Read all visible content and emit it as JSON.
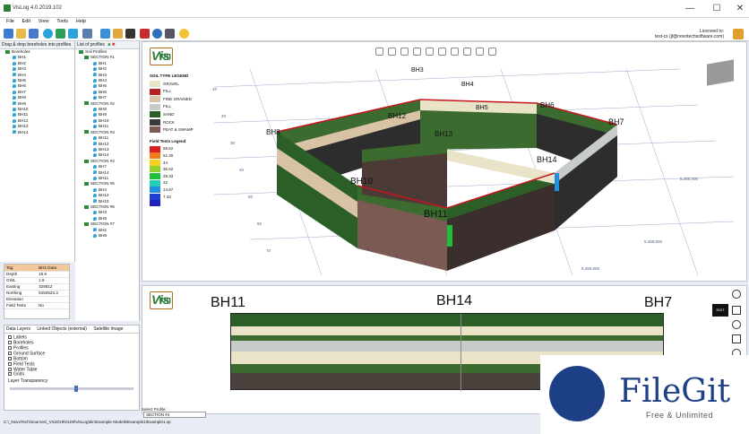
{
  "window": {
    "title": "VisLog 4.0.2019.102",
    "minimize": "—",
    "maximize": "☐",
    "close": "✕"
  },
  "menu": [
    "File",
    "Edit",
    "View",
    "Tools",
    "Help"
  ],
  "license": {
    "line1": "Licensed to:",
    "line2": "test-cs (jf@novotechsoftware.com)"
  },
  "boreholes_panel": {
    "header": "Drag & drop boreholes into profiles",
    "root": "Boreholes",
    "items": [
      "BH1",
      "BH2",
      "BH3",
      "BH4",
      "BH5",
      "BH6",
      "BH7",
      "BH8",
      "BH9",
      "BH10",
      "BH11",
      "BH12",
      "BH13",
      "BH14"
    ]
  },
  "profiles_panel": {
    "header": "List of profiles",
    "root": "Soil Profiles",
    "sections": [
      {
        "name": "SECTION #1",
        "items": [
          "BH1",
          "BH2",
          "BH3",
          "BH4",
          "BH5",
          "BH6",
          "BH7"
        ]
      },
      {
        "name": "SECTION #2",
        "items": [
          "BH8",
          "BH9",
          "BH10",
          "BH11"
        ]
      },
      {
        "name": "SECTION #3",
        "items": [
          "BH11",
          "BH12",
          "BH13",
          "BH14"
        ]
      },
      {
        "name": "SECTION #4",
        "items": [
          "BH7",
          "BH14",
          "BH11"
        ]
      },
      {
        "name": "SECTION #5",
        "items": [
          "BH4",
          "BH12",
          "BH10"
        ]
      },
      {
        "name": "SECTION #6",
        "items": [
          "BH3",
          "BH9"
        ]
      },
      {
        "name": "SECTION #7",
        "items": [
          "BH2",
          "BH8"
        ]
      }
    ]
  },
  "properties": {
    "headers": [
      "Tag",
      "BH1 Data"
    ],
    "rows": [
      [
        "Depth",
        "16.6"
      ],
      [
        "GWL",
        "1.9"
      ],
      [
        "Easting",
        "328812"
      ],
      [
        "Northing",
        "5450523.3"
      ],
      [
        "Elevation",
        ""
      ],
      [
        "Field Tests",
        "No"
      ]
    ]
  },
  "layers": {
    "tabs": [
      "Data Layers",
      "Linked Objects (external)",
      "Satellite Image"
    ],
    "items": [
      "Labels",
      "Boreholes",
      "Profiles",
      "Ground Surface",
      "Bottom",
      "Field Tests",
      "Water Table",
      "Grids"
    ],
    "transparency_label": "Layer Transparency"
  },
  "soil_legend": {
    "title": "SOIL TYPE LEGEND",
    "items": [
      {
        "label": "GRAVEL",
        "color": "#e9e3c8"
      },
      {
        "label": "FILL",
        "color": "#b81f1f"
      },
      {
        "label": "FINE GRAINED",
        "color": "#d8c3a6"
      },
      {
        "label": "FILL",
        "color": "#c7ccc9"
      },
      {
        "label": "SAND",
        "color": "#2c5e27"
      },
      {
        "label": "ROCK",
        "color": "#3a3a3a"
      },
      {
        "label": "PEAT & SWAMP",
        "color": "#7a5a52"
      }
    ]
  },
  "field_legend": {
    "title": "Field Tests Legend",
    "items": [
      {
        "label": "58.62",
        "color": "#d81f1f"
      },
      {
        "label": "51.30",
        "color": "#f37a1f"
      },
      {
        "label": "44",
        "color": "#f4d21f"
      },
      {
        "label": "36.62",
        "color": "#8fd22c"
      },
      {
        "label": "29.33",
        "color": "#1fbf3a"
      },
      {
        "label": "22",
        "color": "#1fcfb8"
      },
      {
        "label": "14.67",
        "color": "#1f8fe0"
      },
      {
        "label": "7.33",
        "color": "#1f3fd8"
      },
      {
        "label": "",
        "color": "#2020c0"
      }
    ]
  },
  "view3d_labels": {
    "boreholes": [
      "BH3",
      "BH4",
      "BH5",
      "BH6",
      "BH7",
      "BH8",
      "BH12",
      "BH13",
      "BH14",
      "BH10",
      "BH11"
    ],
    "axis_ticks": [
      "10",
      "20",
      "30",
      "40",
      "50",
      "60",
      "70"
    ],
    "grid_values": [
      "5,450,400",
      "5,450,500",
      "5,450,600"
    ]
  },
  "view2d_labels": {
    "boreholes": [
      "BH11",
      "BH14",
      "BH7"
    ],
    "right_label": "EDIT"
  },
  "profile_select": {
    "label": "Select Profile:",
    "value": "SECTION #4"
  },
  "status": {
    "path": "C:\\_NovoTech\\Sources\\_VS2019\\GUM\\VisLog\\bin\\Example Models\\Example1\\Example1.vp"
  },
  "watermark": {
    "title": "FileGit",
    "subtitle": "Free & Unlimited"
  },
  "logo": {
    "v": "Vis",
    "l": "log"
  }
}
